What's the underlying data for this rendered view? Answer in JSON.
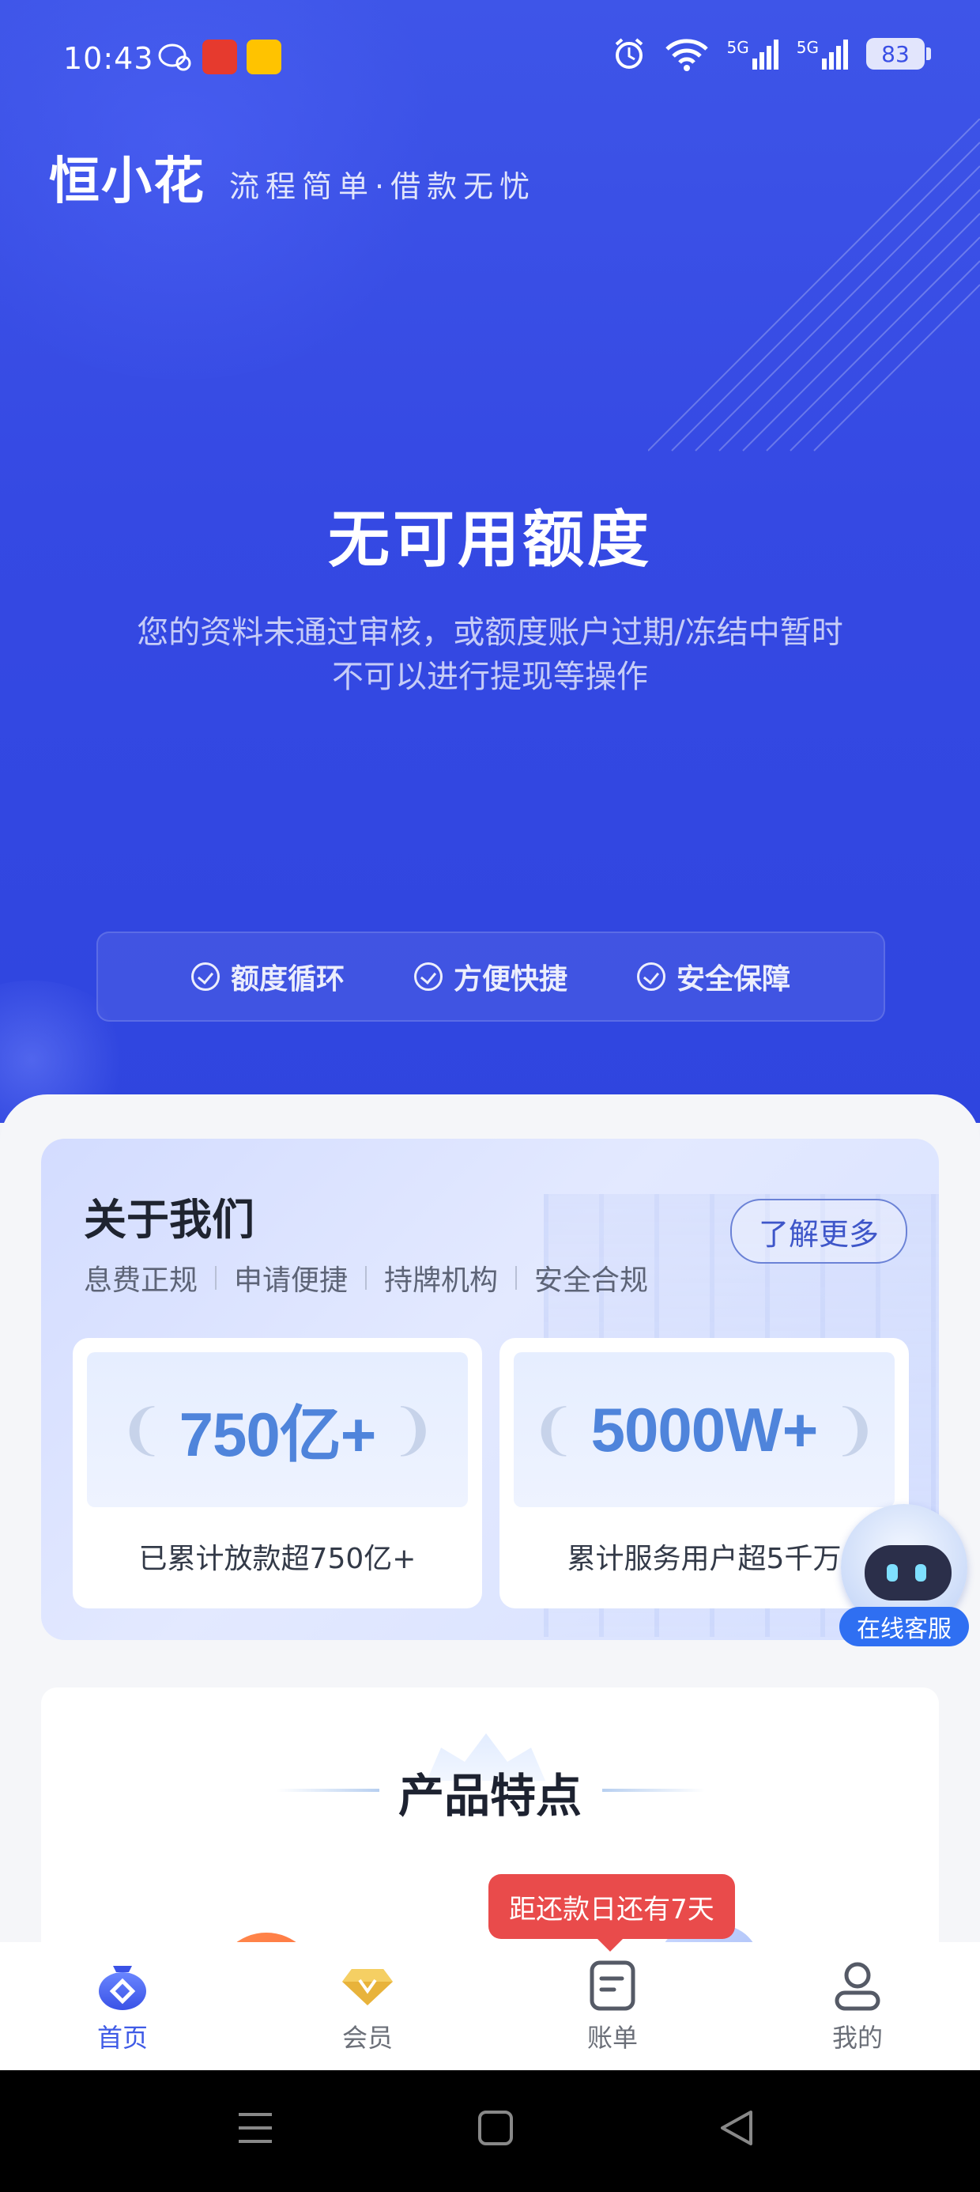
{
  "status_bar": {
    "time": "10:43",
    "network1": "5G",
    "network2": "5G",
    "battery": "83"
  },
  "brand": {
    "logo": "恒小花",
    "slogan": "流程简单·借款无忧"
  },
  "hero": {
    "title": "无可用额度",
    "description_line1": "您的资料未通过审核，或额度账户过期/冻结中暂时",
    "description_line2": "不可以进行提现等操作",
    "features": [
      "额度循环",
      "方便快捷",
      "安全保障"
    ]
  },
  "about": {
    "heading": "关于我们",
    "tags": [
      "息费正规",
      "申请便捷",
      "持牌机构",
      "安全合规"
    ],
    "more_button": "了解更多",
    "stats": [
      {
        "value": "750亿+",
        "caption": "已累计放款超750亿+"
      },
      {
        "value": "5000W+",
        "caption": "累计服务用户超5千万"
      }
    ]
  },
  "service": {
    "label": "在线客服"
  },
  "product": {
    "title": "产品特点"
  },
  "repay_tip": "距还款日还有7天",
  "tabbar": {
    "items": [
      {
        "label": "首页",
        "icon": "home-icon",
        "active": true
      },
      {
        "label": "会员",
        "icon": "vip-diamond-icon",
        "active": false
      },
      {
        "label": "账单",
        "icon": "bill-icon",
        "active": false
      },
      {
        "label": "我的",
        "icon": "profile-icon",
        "active": false
      }
    ]
  },
  "colors": {
    "primary": "#3a52e6",
    "tip_red": "#e94b4b",
    "stat_blue": "#4f84db"
  }
}
